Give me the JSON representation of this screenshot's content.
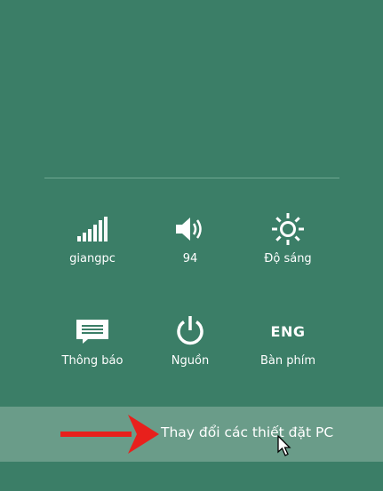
{
  "quick_settings": [
    {
      "label": "giangpc",
      "icon": "wifi-signal-icon"
    },
    {
      "label": "94",
      "icon": "volume-icon"
    },
    {
      "label": "Độ sáng",
      "icon": "brightness-icon"
    },
    {
      "label": "Thông báo",
      "icon": "notifications-icon"
    },
    {
      "label": "Nguồn",
      "icon": "power-icon"
    },
    {
      "label": "Bàn phím",
      "icon": "keyboard-language",
      "text": "ENG"
    }
  ],
  "change_settings": {
    "label": "Thay đổi các thiết đặt PC"
  },
  "colors": {
    "pane": "#3b7e67",
    "highlight": "#6a9c89",
    "arrow": "#e8201c"
  }
}
